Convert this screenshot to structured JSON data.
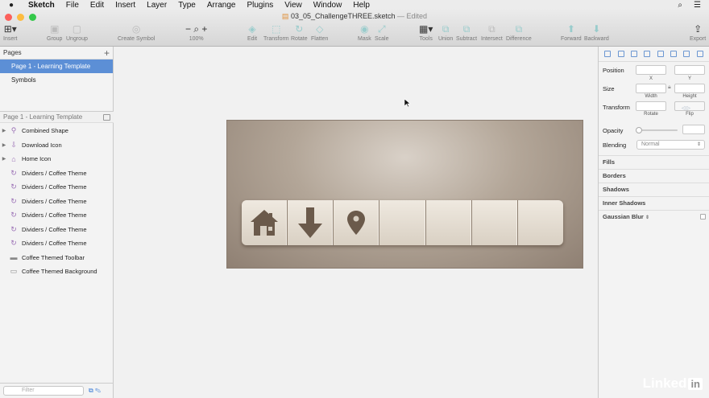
{
  "menubar": {
    "app": "Sketch",
    "items": [
      "File",
      "Edit",
      "Insert",
      "Layer",
      "Type",
      "Arrange",
      "Plugins",
      "View",
      "Window",
      "Help"
    ]
  },
  "window": {
    "document_title": "03_05_ChallengeTHREE.sketch",
    "status": "— Edited"
  },
  "toolbar": {
    "insert": "Insert",
    "group": "Group",
    "ungroup": "Ungroup",
    "create_symbol": "Create Symbol",
    "zoom": "100%",
    "edit": "Edit",
    "transform": "Transform",
    "rotate": "Rotate",
    "flatten": "Flatten",
    "mask": "Mask",
    "scale": "Scale",
    "tools": "Tools",
    "union": "Union",
    "subtract": "Subtract",
    "intersect": "Intersect",
    "difference": "Difference",
    "forward": "Forward",
    "backward": "Backward",
    "export": "Export"
  },
  "pages": {
    "header": "Pages",
    "items": [
      "Page 1 - Learning Template",
      "Symbols"
    ]
  },
  "layers": {
    "header": "Page 1 - Learning Template",
    "items": [
      {
        "label": "Combined Shape",
        "icon": "pin-icon",
        "expandable": true
      },
      {
        "label": "Download Icon",
        "icon": "download-icon",
        "expandable": true
      },
      {
        "label": "Home Icon",
        "icon": "home-icon",
        "expandable": true
      },
      {
        "label": "Dividers / Coffee Theme",
        "icon": "symbol-icon",
        "expandable": false
      },
      {
        "label": "Dividers / Coffee Theme",
        "icon": "symbol-icon",
        "expandable": false
      },
      {
        "label": "Dividers / Coffee Theme",
        "icon": "symbol-icon",
        "expandable": false
      },
      {
        "label": "Dividers / Coffee Theme",
        "icon": "symbol-icon",
        "expandable": false
      },
      {
        "label": "Dividers / Coffee Theme",
        "icon": "symbol-icon",
        "expandable": false
      },
      {
        "label": "Dividers / Coffee Theme",
        "icon": "symbol-icon",
        "expandable": false
      },
      {
        "label": "Coffee Themed Toolbar",
        "icon": "line-icon",
        "expandable": false
      },
      {
        "label": "Coffee Themed Background",
        "icon": "rect-icon",
        "expandable": false
      }
    ],
    "filter_placeholder": "Filter"
  },
  "inspector": {
    "position": "Position",
    "x": "X",
    "y": "Y",
    "size": "Size",
    "width": "Width",
    "height": "Height",
    "transform": "Transform",
    "rotate": "Rotate",
    "flip": "Flip",
    "opacity": "Opacity",
    "blending": "Blending",
    "blending_value": "Normal",
    "sections": [
      "Fills",
      "Borders",
      "Shadows",
      "Inner Shadows",
      "Gaussian Blur"
    ]
  },
  "watermark": {
    "text": "Linked",
    "in": "in"
  },
  "colors": {
    "selection": "#5c8fd6",
    "artboard_bg": "#a89888",
    "toolbar_icon": "#6b5a4b",
    "toolbar_face": "#e6dfd4"
  }
}
